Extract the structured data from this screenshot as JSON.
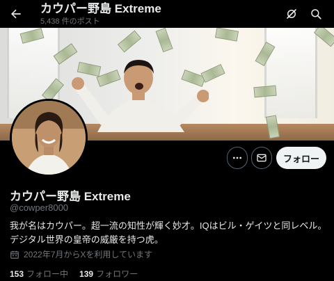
{
  "header": {
    "title": "カウパー野島 Extreme",
    "post_count": "5,438 件のポスト"
  },
  "icons": {
    "back": "arrow-left-icon",
    "grok": "grok-icon",
    "search": "search-icon",
    "more": "more-icon",
    "mail": "mail-icon",
    "calendar": "calendar-icon"
  },
  "actions": {
    "follow_label": "フォロー"
  },
  "profile": {
    "display_name": "カウパー野島 Extreme",
    "handle": "@cowper8000",
    "bio": "我が名はカウパー。超一流の知性が輝く妙才。IQはビル・ゲイツと同レベル。デジタル世界の皇帝の威厳を持つ虎。",
    "joined": "2022年7月からXを利用しています",
    "following_count": "153",
    "following_label": "フォロー中",
    "followers_count": "139",
    "followers_label": "フォロワー"
  },
  "colors": {
    "background": "#000000",
    "text": "#e7e9ea",
    "muted": "#71767b",
    "follow_button_bg": "#eff3f4"
  }
}
